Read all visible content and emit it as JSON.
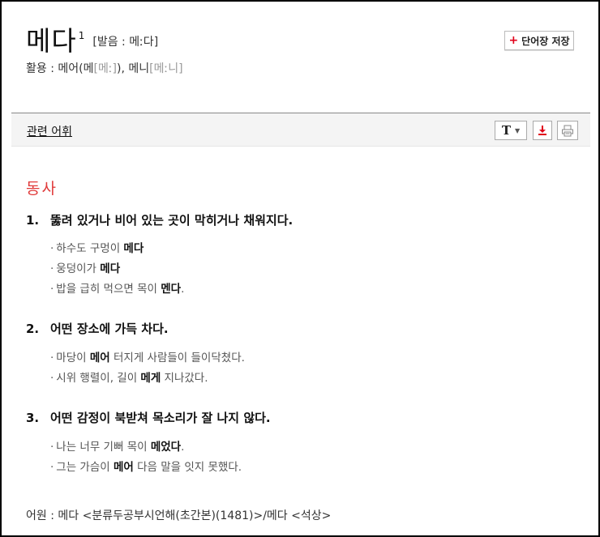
{
  "entry": {
    "headword": "메다",
    "homonym_no": "1",
    "pronunciation": "[발음 : 메ː다]",
    "conjugation": {
      "label": "활용 : 메어(메",
      "p1": "[메ː]",
      "mid": "), 메니",
      "p2": "[메ː니]"
    }
  },
  "toolbar": {
    "save_plus": "+",
    "save_label": "단어장 저장",
    "related_link": "관련 어휘",
    "font_button": "T",
    "font_caret": "▼"
  },
  "pos": "동사",
  "senses": [
    {
      "num": "1.",
      "definition": "뚫려 있거나 비어 있는 곳이 막히거나 채워지다.",
      "examples": [
        {
          "before": "하수도 구멍이 ",
          "bold": "메다",
          "after": ""
        },
        {
          "before": "웅덩이가 ",
          "bold": "메다",
          "after": ""
        },
        {
          "before": "밥을 급히 먹으면 목이 ",
          "bold": "멘다",
          "after": "."
        }
      ]
    },
    {
      "num": "2.",
      "definition": "어떤 장소에 가득 차다.",
      "examples": [
        {
          "before": "마당이 ",
          "bold": "메어",
          "after": " 터지게 사람들이 들이닥쳤다."
        },
        {
          "before": "시위 행렬이, 길이 ",
          "bold": "메게",
          "after": " 지나갔다."
        }
      ]
    },
    {
      "num": "3.",
      "definition": "어떤 감정이 북받쳐 목소리가 잘 나지 않다.",
      "examples": [
        {
          "before": "나는 너무 기뻐 목이 ",
          "bold": "메었다",
          "after": "."
        },
        {
          "before": "그는 가슴이 ",
          "bold": "메어",
          "after": " 다음 말을 잇지 못했다."
        }
      ]
    }
  ],
  "etymology": "어원 : 메다 <분류두공부시언해(초간본)(1481)>/메다 <석상>",
  "colors": {
    "pos": "#e03a3a",
    "plus": "#e0001a",
    "download": "#e0001a"
  },
  "icons": [
    "font-size-icon",
    "download-icon",
    "print-icon"
  ]
}
